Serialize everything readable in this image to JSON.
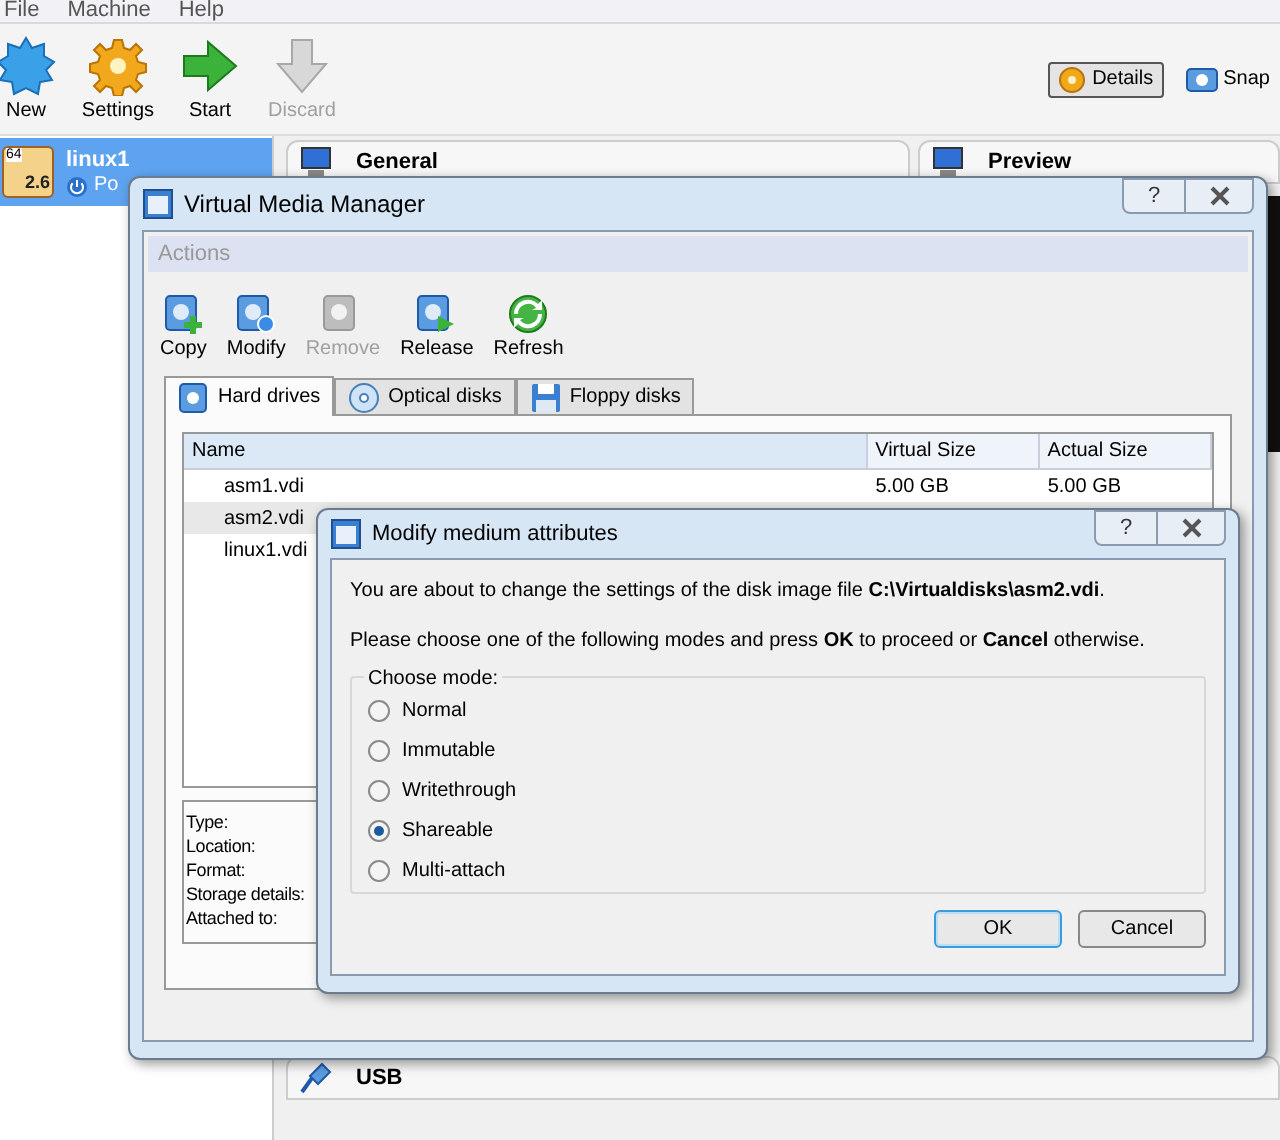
{
  "main_window": {
    "menu": [
      "File",
      "Machine",
      "Help"
    ],
    "toolbar": [
      {
        "label": "New",
        "kind": "new",
        "disabled": false
      },
      {
        "label": "Settings",
        "kind": "settings",
        "disabled": false
      },
      {
        "label": "Start",
        "kind": "start",
        "disabled": false
      },
      {
        "label": "Discard",
        "kind": "discard",
        "disabled": true
      }
    ],
    "view_buttons": [
      {
        "label": "Details",
        "kind": "details",
        "selected": true
      },
      {
        "label": "Snap",
        "kind": "snapshots",
        "selected": false
      }
    ],
    "vm_list": [
      {
        "name": "linux1",
        "arch_badge": "64",
        "os_badge": "2.6",
        "state": "Po",
        "selected": true
      }
    ],
    "sections": [
      {
        "title": "General",
        "kind": "monitor"
      },
      {
        "title": "Preview",
        "kind": "monitor"
      },
      {
        "title": "USB",
        "kind": "usb"
      }
    ]
  },
  "media_manager": {
    "title": "Virtual Media Manager",
    "help_label": "?",
    "actions_label": "Actions",
    "toolbar": [
      {
        "label": "Copy",
        "kind": "copy",
        "disabled": false
      },
      {
        "label": "Modify",
        "kind": "modify",
        "disabled": false
      },
      {
        "label": "Remove",
        "kind": "remove",
        "disabled": true
      },
      {
        "label": "Release",
        "kind": "release",
        "disabled": false
      },
      {
        "label": "Refresh",
        "kind": "refresh",
        "disabled": false
      }
    ],
    "tabs": [
      {
        "label": "Hard drives",
        "kind": "hdd",
        "selected": true
      },
      {
        "label": "Optical disks",
        "kind": "optical",
        "selected": false
      },
      {
        "label": "Floppy disks",
        "kind": "floppy",
        "selected": false
      }
    ],
    "table": {
      "columns": [
        "Name",
        "Virtual Size",
        "Actual Size"
      ],
      "rows": [
        {
          "name": "asm1.vdi",
          "virtual_size": "5.00 GB",
          "actual_size": "5.00 GB",
          "selected": false
        },
        {
          "name": "asm2.vdi",
          "selected": true
        },
        {
          "name": "linux1.vdi",
          "selected": false
        }
      ]
    },
    "details_labels": [
      "Type:",
      "Location:",
      "Format:",
      "Storage details:",
      "Attached to:"
    ]
  },
  "modify_dialog": {
    "title": "Modify medium attributes",
    "help_label": "?",
    "message": "You are about to change the settings of the disk image file **C:\\Virtualdisks\\asm2.vdi**.",
    "instruction": "Please choose one of the following modes and press **OK** to proceed or **Cancel** otherwise.",
    "group_label": "Choose mode:",
    "modes": [
      {
        "label": "Normal",
        "selected": false
      },
      {
        "label": "Immutable",
        "selected": false
      },
      {
        "label": "Writethrough",
        "selected": false
      },
      {
        "label": "Shareable",
        "selected": true
      },
      {
        "label": "Multi-attach",
        "selected": false
      }
    ],
    "buttons": [
      {
        "label": "OK",
        "default": true
      },
      {
        "label": "Cancel",
        "default": false
      }
    ]
  }
}
